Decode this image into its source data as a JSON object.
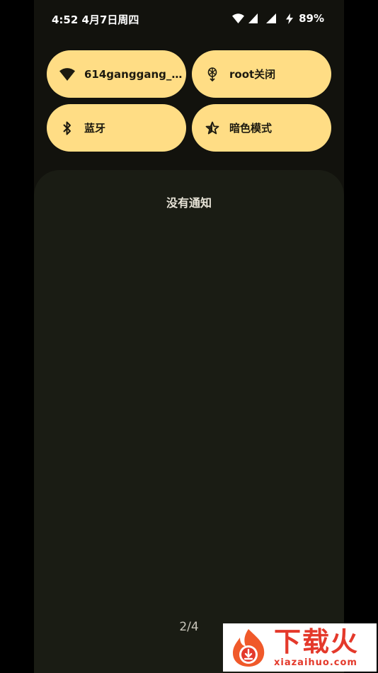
{
  "status_bar": {
    "time_date": "4:52 4月7日周四",
    "battery": "89%",
    "icons": [
      "wifi-icon",
      "signal-icon",
      "signal-icon",
      "charging-icon"
    ]
  },
  "quick_settings": {
    "tiles": [
      {
        "label": "614ganggang_...",
        "icon": "wifi-icon"
      },
      {
        "label": "root关闭",
        "icon": "root-icon"
      },
      {
        "label": "蓝牙",
        "icon": "bluetooth-icon"
      },
      {
        "label": "暗色模式",
        "icon": "dark-mode-icon"
      }
    ],
    "tile_color": "#ffdd85"
  },
  "notifications": {
    "empty_text": "没有通知",
    "page_indicator": "2/4"
  },
  "watermark": {
    "title": "下载火",
    "subtitle": "xiazaihuo.com",
    "color": "#e4392b"
  }
}
